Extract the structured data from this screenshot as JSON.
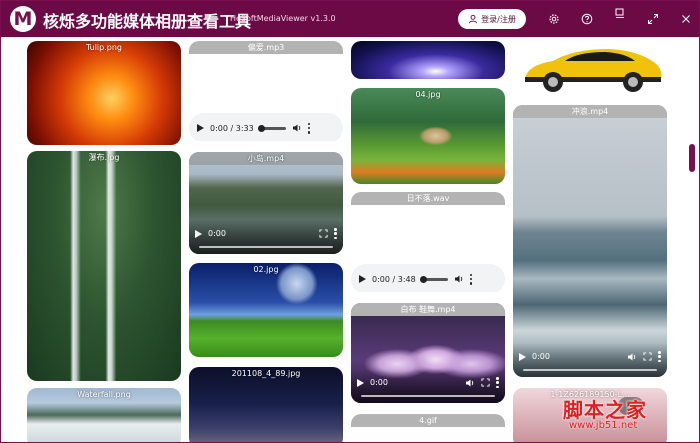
{
  "app": {
    "title": "核烁多功能媒体相册查看工具",
    "version": "HeSoftMediaViewer v1.3.0",
    "login_label": "登录/注册"
  },
  "icons": {
    "settings": "gear-icon",
    "help": "help-icon",
    "minimize": "minimize-icon",
    "maximize": "maximize-icon",
    "close": "close-icon",
    "user": "user-icon"
  },
  "colors": {
    "titlebar": "#6c0a45",
    "accent": "#7a0e4f"
  },
  "media": {
    "tulip": "Tulip.png",
    "waterfall_cn": "瀑布.jpg",
    "waterfall_en": "Waterfall.png",
    "love_mp3": "偏爱.mp3",
    "island_mp4": "小岛.mp4",
    "img02": "02.jpg",
    "img201108": "201108_4_89.jpg",
    "img04": "04.jpg",
    "sunset_wav": "日不落.wav",
    "dance_mp4": "白布 鞋舞.mp4",
    "gif4": "4.gif",
    "surf_mp4": "冲浪.mp4",
    "img_bottom_right": "1-1Z626189150-L..."
  },
  "audio": {
    "love_time": "0:00 / 3:33",
    "sunset_time": "0:00 / 3:48"
  },
  "video": {
    "island_time": "0:00",
    "dance_time": "0:00",
    "surf_time": "0:00"
  },
  "watermark": {
    "big": "脚本之家",
    "small": "www.jb51.net"
  }
}
